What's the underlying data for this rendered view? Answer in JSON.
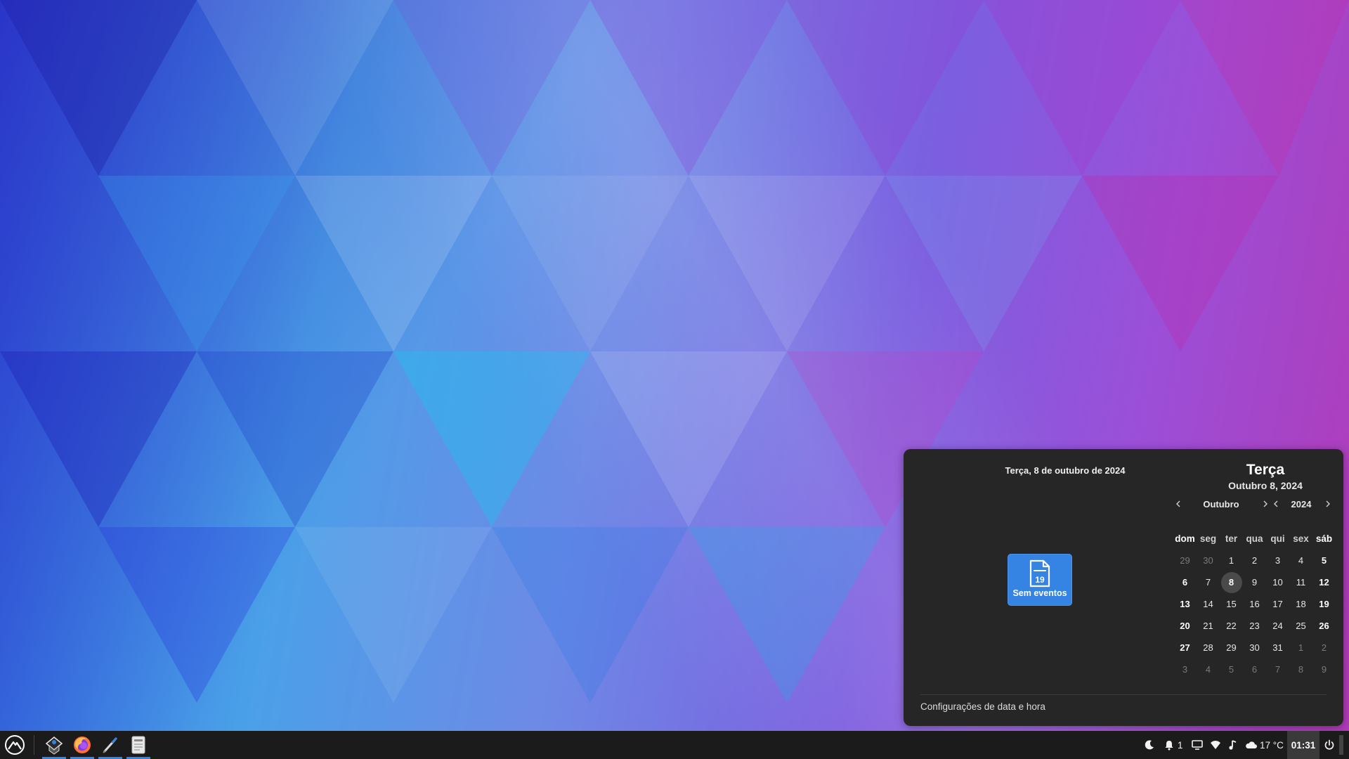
{
  "popup": {
    "left_date": "Terça, 8 de outubro de 2024",
    "no_events_label": "Sem eventos",
    "no_events_icon_number": "19",
    "weekday": "Terça",
    "full_date": "Outubro 8, 2024",
    "month_label": "Outubro",
    "year_label": "2024",
    "weekday_headers": [
      "dom",
      "seg",
      "ter",
      "qua",
      "qui",
      "sex",
      "sáb"
    ],
    "weeks": [
      [
        "29",
        "30",
        "1",
        "2",
        "3",
        "4",
        "5"
      ],
      [
        "6",
        "7",
        "8",
        "9",
        "10",
        "11",
        "12"
      ],
      [
        "13",
        "14",
        "15",
        "16",
        "17",
        "18",
        "19"
      ],
      [
        "20",
        "21",
        "22",
        "23",
        "24",
        "25",
        "26"
      ],
      [
        "27",
        "28",
        "29",
        "30",
        "31",
        "1",
        "2"
      ],
      [
        "3",
        "4",
        "5",
        "6",
        "7",
        "8",
        "9"
      ]
    ],
    "selected_day": "8",
    "settings_link": "Configurações de data e hora"
  },
  "taskbar": {
    "apps": [
      {
        "name": "launcher",
        "icon": "linux-lite-logo-icon"
      },
      {
        "name": "app-manager",
        "icon": "package-icon"
      },
      {
        "name": "firefox",
        "icon": "firefox-icon"
      },
      {
        "name": "text-editor",
        "icon": "pen-icon"
      },
      {
        "name": "file-archive",
        "icon": "document-icon"
      }
    ],
    "tray": {
      "notifications_count": "1",
      "weather": "17 °C",
      "clock": "01:31"
    }
  },
  "colors": {
    "accent": "#3584e4",
    "popup_bg": "#262626",
    "taskbar_bg": "#1b1b1b"
  }
}
